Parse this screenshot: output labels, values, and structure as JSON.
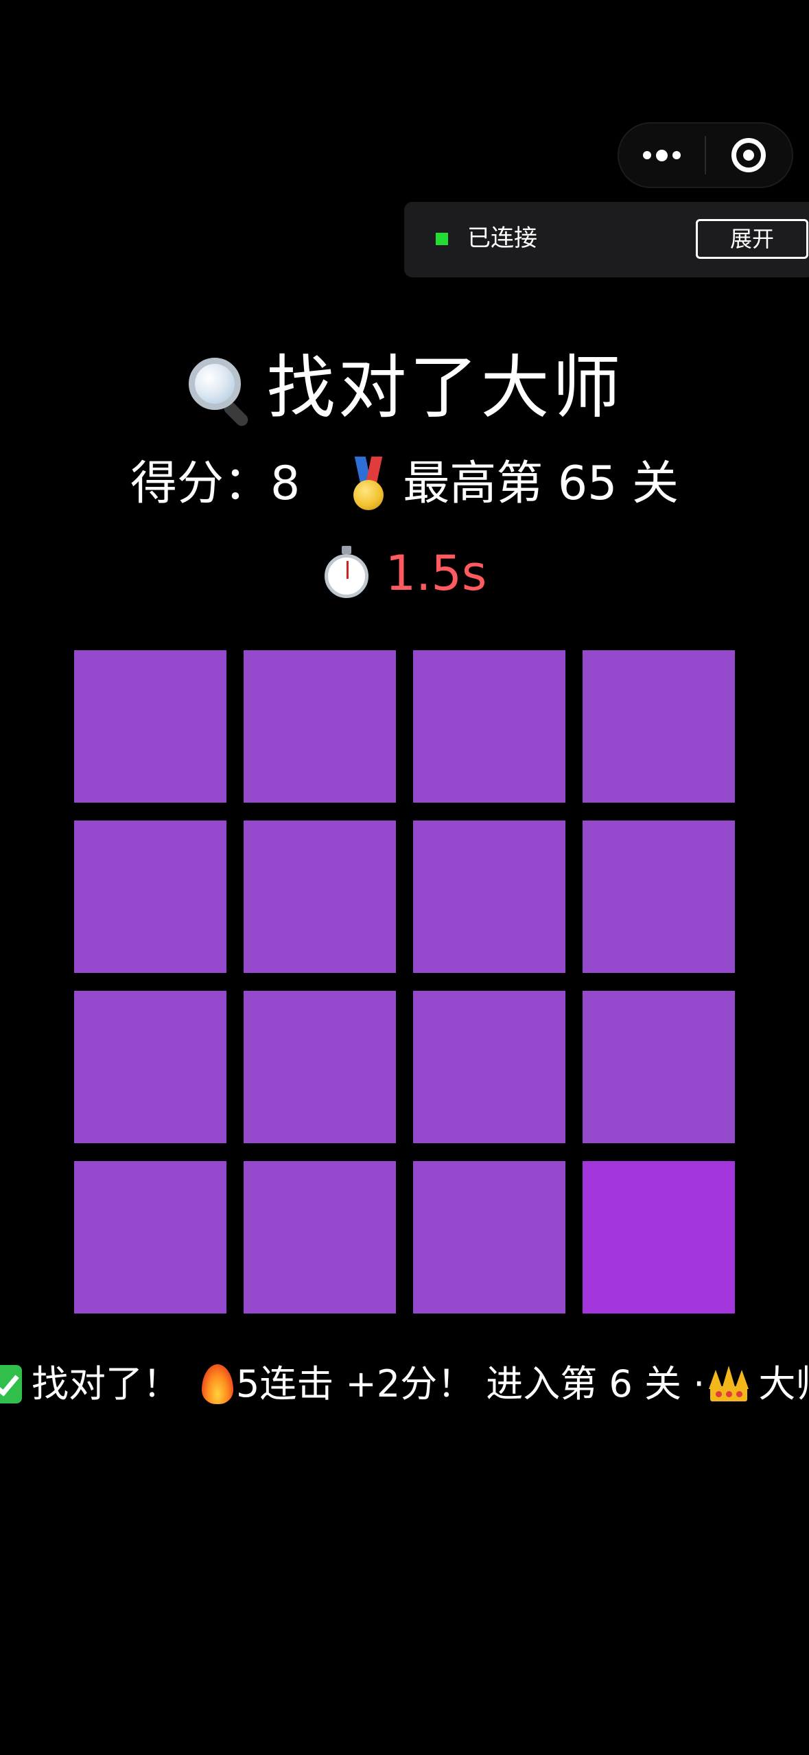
{
  "capsule": {
    "more_icon": "more-dots-icon",
    "close_icon": "target-circle-icon"
  },
  "connection": {
    "status_text": "已连接",
    "status_color": "#22dd33",
    "expand_label": "展开"
  },
  "header": {
    "title_icon": "magnifier-icon",
    "title": "找对了大师"
  },
  "score": {
    "label": "得分：",
    "value": "8",
    "best_icon": "medal-icon",
    "best_text": "最高第 65 关"
  },
  "timer": {
    "icon": "stopwatch-icon",
    "value": "1.5s",
    "color": "#ff5a5f"
  },
  "grid": {
    "rows": 4,
    "cols": 4,
    "base_color": "#9448cc",
    "odd_color": "#a235db",
    "odd_index": 15
  },
  "feedback": {
    "part1": "找对了！",
    "part2": "5连击 +2分！ 进入第 6 关 ·",
    "part3": "大师"
  }
}
